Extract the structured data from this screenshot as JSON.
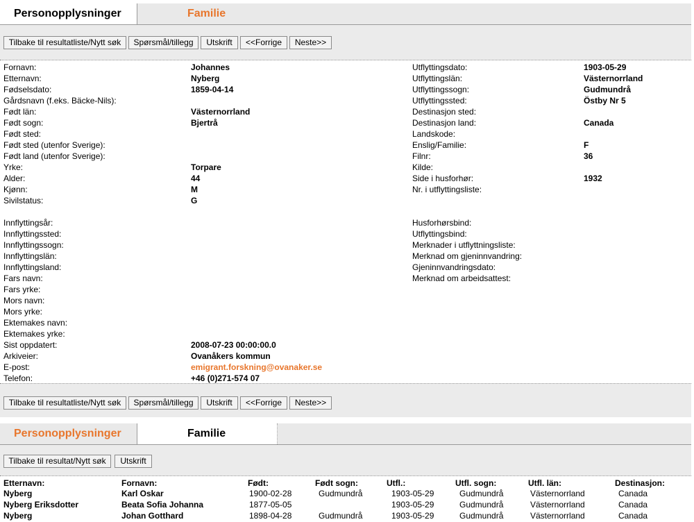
{
  "tabs_top": {
    "personal": "Personopplysninger",
    "family": "Familie"
  },
  "toolbar_top": {
    "back": "Tilbake til resultatliste/Nytt søk",
    "question": "Spørsmål/tillegg",
    "print": "Utskrift",
    "prev": "<<Forrige",
    "next": "Neste>>"
  },
  "left_fields": [
    {
      "label": "Fornavn:",
      "value": "Johannes"
    },
    {
      "label": "Etternavn:",
      "value": "Nyberg"
    },
    {
      "label": "Fødselsdato:",
      "value": "1859-04-14"
    },
    {
      "label": "Gårdsnavn (f.eks. Bäcke-Nils):",
      "value": ""
    },
    {
      "label": "Født län:",
      "value": "Västernorrland"
    },
    {
      "label": "Født sogn:",
      "value": "Bjertrå"
    },
    {
      "label": "Født sted:",
      "value": ""
    },
    {
      "label": "Født sted (utenfor Sverige):",
      "value": ""
    },
    {
      "label": "Født land (utenfor Sverige):",
      "value": ""
    },
    {
      "label": "Yrke:",
      "value": "Torpare"
    },
    {
      "label": "Alder:",
      "value": "44"
    },
    {
      "label": "Kjønn:",
      "value": "M"
    },
    {
      "label": "Sivilstatus:",
      "value": "G"
    }
  ],
  "left_fields2": [
    {
      "label": "Innflyttingsår:",
      "value": ""
    },
    {
      "label": "Innflyttingssted:",
      "value": ""
    },
    {
      "label": "Innflyttingssogn:",
      "value": ""
    },
    {
      "label": "Innflyttingslän:",
      "value": ""
    },
    {
      "label": "Innflyttingsland:",
      "value": ""
    },
    {
      "label": "Fars navn:",
      "value": ""
    },
    {
      "label": "Fars yrke:",
      "value": ""
    },
    {
      "label": "Mors navn:",
      "value": ""
    },
    {
      "label": "Mors yrke:",
      "value": ""
    },
    {
      "label": "Ektemakes navn:",
      "value": ""
    },
    {
      "label": "Ektemakes yrke:",
      "value": ""
    },
    {
      "label": "Sist oppdatert:",
      "value": "2008-07-23 00:00:00.0"
    },
    {
      "label": "Arkiveier:",
      "value": "Ovanåkers kommun"
    },
    {
      "label": "E-post:",
      "value": "emigrant.forskning@ovanaker.se"
    },
    {
      "label": "Telefon:",
      "value": "+46 (0)271-574 07"
    }
  ],
  "right_fields": [
    {
      "label": "Utflyttingsdato:",
      "value": "1903-05-29"
    },
    {
      "label": "Utflyttingslän:",
      "value": "Västernorrland"
    },
    {
      "label": "Utflyttingssogn:",
      "value": "Gudmundrå"
    },
    {
      "label": "Utflyttingssted:",
      "value": "Östby Nr 5"
    },
    {
      "label": "Destinasjon sted:",
      "value": ""
    },
    {
      "label": "Destinasjon land:",
      "value": "Canada"
    },
    {
      "label": "Landskode:",
      "value": ""
    },
    {
      "label": "Enslig/Familie:",
      "value": "F"
    },
    {
      "label": "Filnr:",
      "value": "36"
    },
    {
      "label": "Kilde:",
      "value": ""
    },
    {
      "label": "Side i husforhør:",
      "value": "1932"
    },
    {
      "label": "Nr. i utflyttingsliste:",
      "value": ""
    }
  ],
  "right_fields2": [
    {
      "label": "Husforhørsbind:",
      "value": ""
    },
    {
      "label": "Utflyttingsbind:",
      "value": ""
    },
    {
      "label": "Merknader i utflyttningsliste:",
      "value": ""
    },
    {
      "label": "Merknad om gjeninnvandring:",
      "value": ""
    },
    {
      "label": "Gjeninnvandringsdato:",
      "value": ""
    },
    {
      "label": "Merknad om arbeidsattest:",
      "value": ""
    }
  ],
  "toolbar_bottom": {
    "back": "Tilbake til resultatliste/Nytt søk",
    "question": "Spørsmål/tillegg",
    "print": "Utskrift",
    "prev": "<<Forrige",
    "next": "Neste>>"
  },
  "tabs_family": {
    "personal": "Personopplysninger",
    "family": "Familie"
  },
  "toolbar_family": {
    "back": "Tilbake til resultat/Nytt søk",
    "print": "Utskrift"
  },
  "family_table": {
    "headers": [
      "Etternavn:",
      "Fornavn:",
      "Født:",
      "Født sogn:",
      "Utfl.:",
      "Utfl. sogn:",
      "Utfl. län:",
      "Destinasjon:"
    ],
    "rows": [
      [
        "Nyberg",
        "Karl Oskar",
        "1900-02-28",
        "Gudmundrå",
        "1903-05-29",
        "Gudmundrå",
        "Västernorrland",
        "Canada"
      ],
      [
        "Nyberg Eriksdotter",
        "Beata Sofia Johanna",
        "1877-05-05",
        "",
        "1903-05-29",
        "Gudmundrå",
        "Västernorrland",
        "Canada"
      ],
      [
        "Nyberg",
        "Johan Gotthard",
        "1898-04-28",
        "Gudmundrå",
        "1903-05-29",
        "Gudmundrå",
        "Västernorrland",
        "Canada"
      ]
    ]
  }
}
